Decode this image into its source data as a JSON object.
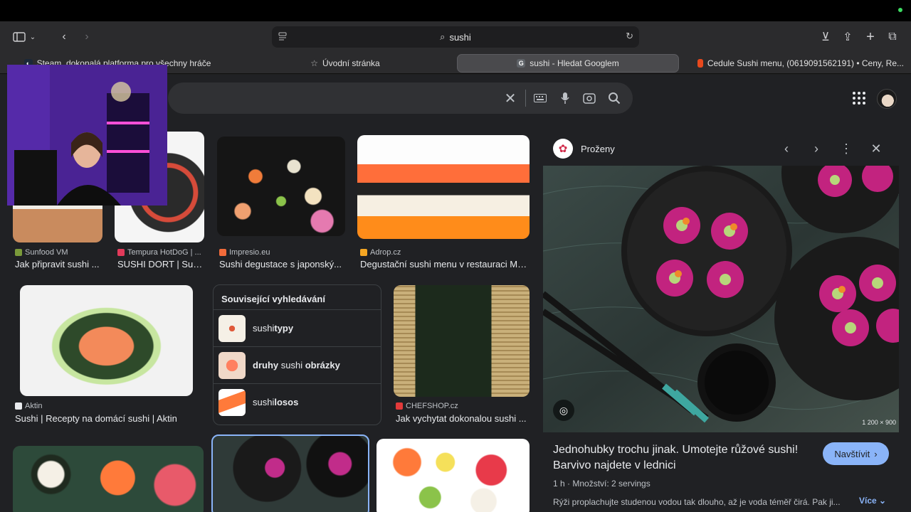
{
  "browser": {
    "url_text": "sushi",
    "tabs": [
      {
        "label": "Steam, dokonalá platforma pro všechny hráče"
      },
      {
        "label": "Úvodní stránka"
      },
      {
        "label": "sushi - Hledat Googlem"
      },
      {
        "label": "Cedule Sushi menu, (0619091562191) • Ceny, Re..."
      }
    ]
  },
  "results": [
    {
      "source": "Sunfood VM",
      "caption": "Jak připravit sushi ..."
    },
    {
      "source": "Tempura HotDoG | ...",
      "caption": "SUSHI DORT | Sus..."
    },
    {
      "source": "Impresio.eu",
      "caption": "Sushi degustace s japonský..."
    },
    {
      "source": "Adrop.cz",
      "caption": "Degustační sushi menu v restauraci Ma..."
    },
    {
      "source": "Aktin",
      "caption": "Sushi | Recepty na domácí sushi | Aktin"
    },
    {
      "source": "CHEFSHOP.cz",
      "caption": "Jak vychytat dokonalou sushi ..."
    }
  ],
  "related": {
    "heading": "Související vyhledávání",
    "items": [
      {
        "pre": "sushi ",
        "bold": "typy",
        "post": ""
      },
      {
        "pre": "",
        "bold": "druhy",
        "mid": " sushi ",
        "bold2": "obrázky"
      },
      {
        "pre": "sushi ",
        "bold": "losos",
        "post": ""
      }
    ]
  },
  "panel": {
    "site_name": "Proženy",
    "dimensions": "1 200 × 900",
    "title": "Jednohubky trochu jinak. Umotejte růžové sushi! Barvivo najdete v lednici",
    "visit_label": "Navštívit",
    "meta": "1 h · Množství: 2 servings",
    "description": "Rýži proplachujte studenou vodou tak dlouho, až je voda téměř čirá. Pak ji...",
    "more_label": "Více"
  },
  "colors": {
    "page_bg": "#202124",
    "accent_blue": "#8ab4f8",
    "panel_text": "#e8eaed"
  }
}
